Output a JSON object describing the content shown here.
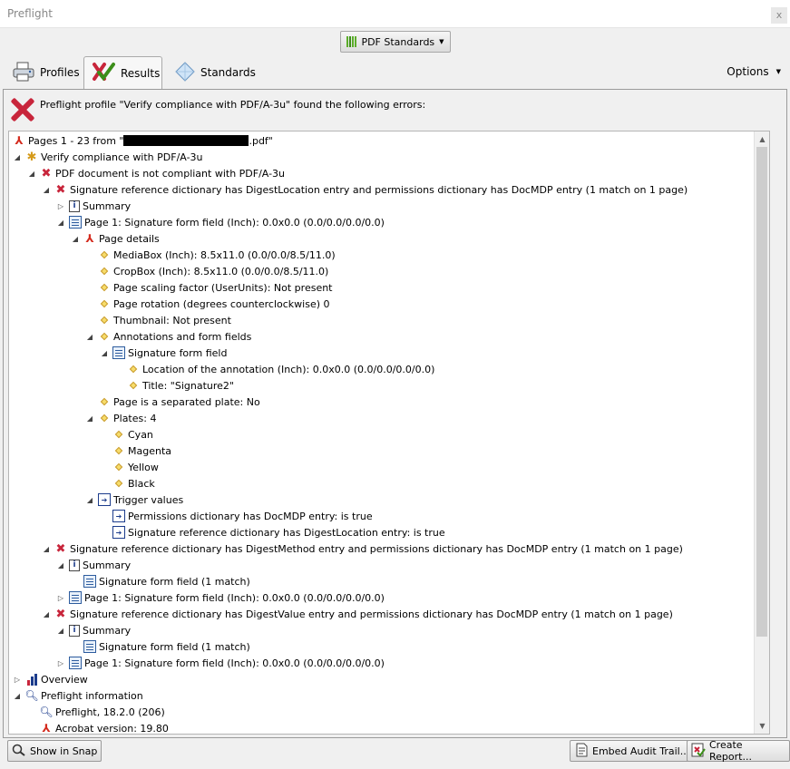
{
  "window": {
    "title": "Preflight",
    "close_glyph": "x"
  },
  "standards_button": {
    "label": "PDF Standards"
  },
  "tabs": [
    {
      "label": "Profiles",
      "icon": "printer-icon"
    },
    {
      "label": "Results",
      "icon": "checkmark-x-icon"
    },
    {
      "label": "Standards",
      "icon": "diamond-icon"
    }
  ],
  "options": {
    "label": "Options"
  },
  "summary": {
    "message": "Preflight profile \"Verify compliance with PDF/A-3u\" found the following errors:"
  },
  "tree": [
    {
      "t": "Pages 1 - 23 from \"",
      "t2": ".pdf\"",
      "redacted": true,
      "icon": "pdf",
      "toggle": ""
    },
    {
      "t": "Verify compliance with PDF/A-3u",
      "icon": "bee",
      "toggle": "◢"
    },
    {
      "t": "PDF document is not compliant with PDF/A-3u",
      "icon": "x",
      "toggle": "◢"
    },
    {
      "t": "Signature reference dictionary has DigestLocation entry and permissions dictionary has DocMDP entry (1 match on 1 page)",
      "icon": "x",
      "toggle": "◢"
    },
    {
      "t": "Summary",
      "icon": "info",
      "toggle": "▷"
    },
    {
      "t": "Page 1: Signature form field (Inch): 0.0x0.0 (0.0/0.0/0.0/0.0)",
      "icon": "form",
      "toggle": "◢"
    },
    {
      "t": "Page details",
      "icon": "pdf",
      "toggle": "◢"
    },
    {
      "t": "MediaBox (Inch): 8.5x11.0 (0.0/0.0/8.5/11.0)",
      "icon": "dot",
      "toggle": ""
    },
    {
      "t": "CropBox (Inch): 8.5x11.0 (0.0/0.0/8.5/11.0)",
      "icon": "dot",
      "toggle": ""
    },
    {
      "t": "Page scaling factor (UserUnits): Not present",
      "icon": "dot",
      "toggle": ""
    },
    {
      "t": "Page rotation (degrees counterclockwise) 0",
      "icon": "dot",
      "toggle": ""
    },
    {
      "t": "Thumbnail: Not present",
      "icon": "dot",
      "toggle": ""
    },
    {
      "t": "Annotations and form fields",
      "icon": "dot",
      "toggle": "◢"
    },
    {
      "t": "Signature form field",
      "icon": "form",
      "toggle": "◢"
    },
    {
      "t": "Location of the annotation (Inch): 0.0x0.0 (0.0/0.0/0.0/0.0)",
      "icon": "dot",
      "toggle": ""
    },
    {
      "t": "Title: \"Signature2\"",
      "icon": "dot",
      "toggle": ""
    },
    {
      "t": "Page is a separated plate: No",
      "icon": "dot",
      "toggle": ""
    },
    {
      "t": "Plates: 4",
      "icon": "dot",
      "toggle": "◢"
    },
    {
      "t": "Cyan",
      "icon": "dot",
      "toggle": ""
    },
    {
      "t": "Magenta",
      "icon": "dot",
      "toggle": ""
    },
    {
      "t": "Yellow",
      "icon": "dot",
      "toggle": ""
    },
    {
      "t": "Black",
      "icon": "dot",
      "toggle": ""
    },
    {
      "t": "Trigger values",
      "icon": "trig",
      "toggle": "◢"
    },
    {
      "t": "Permissions dictionary has DocMDP entry: is true",
      "icon": "trig",
      "toggle": ""
    },
    {
      "t": "Signature reference dictionary has DigestLocation entry: is true",
      "icon": "trig",
      "toggle": ""
    },
    {
      "t": "Signature reference dictionary has DigestMethod entry and permissions dictionary has DocMDP entry (1 match on 1 page)",
      "icon": "x",
      "toggle": "◢"
    },
    {
      "t": "Summary",
      "icon": "info",
      "toggle": "◢"
    },
    {
      "t": "Signature form field (1 match)",
      "icon": "form",
      "toggle": ""
    },
    {
      "t": "Page 1: Signature form field (Inch): 0.0x0.0 (0.0/0.0/0.0/0.0)",
      "icon": "form",
      "toggle": "▷"
    },
    {
      "t": "Signature reference dictionary has DigestValue entry and permissions dictionary has DocMDP entry (1 match on 1 page)",
      "icon": "x",
      "toggle": "◢"
    },
    {
      "t": "Summary",
      "icon": "info",
      "toggle": "◢"
    },
    {
      "t": "Signature form field (1 match)",
      "icon": "form",
      "toggle": ""
    },
    {
      "t": "Page 1: Signature form field (Inch): 0.0x0.0 (0.0/0.0/0.0/0.0)",
      "icon": "form",
      "toggle": "▷"
    },
    {
      "t": "Overview",
      "icon": "chart",
      "toggle": "▷"
    },
    {
      "t": "Preflight information",
      "icon": "mag",
      "toggle": "◢"
    },
    {
      "t": "Preflight, 18.2.0 (206)",
      "icon": "mag",
      "toggle": ""
    },
    {
      "t": "Acrobat version: 19.80",
      "icon": "pdf",
      "toggle": ""
    }
  ],
  "footer": {
    "show_in_snap": "Show in Snap",
    "embed_audit_trail": "Embed Audit Trail...",
    "create_report": "Create Report..."
  },
  "colors": {
    "error_red": "#c8253b",
    "accent_green": "#5cad2b"
  }
}
